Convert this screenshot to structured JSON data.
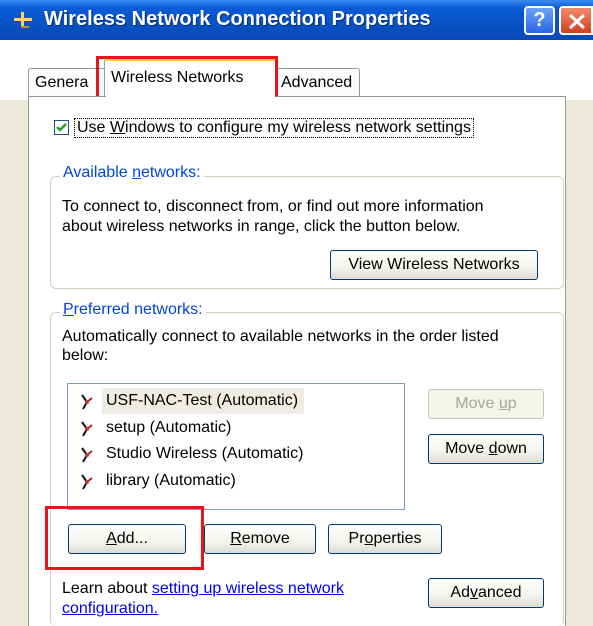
{
  "window": {
    "title": "Wireless Network Connection Properties",
    "help_label": "?"
  },
  "tabs": [
    {
      "label": "Genera"
    },
    {
      "label": "Wireless Networks"
    },
    {
      "label": "Advanced"
    }
  ],
  "settings": {
    "use_windows_label_pre": "Use ",
    "use_windows_label_accel": "W",
    "use_windows_label_post": "indows to configure my wireless network settings",
    "use_windows_checked": true
  },
  "available": {
    "legend_pre": "Available ",
    "legend_accel": "n",
    "legend_post": "etworks:",
    "desc_line1": "To connect to, disconnect from, or find out more information",
    "desc_line2": "about wireless networks in range, click the button below.",
    "view_button": "View Wireless Networks"
  },
  "preferred": {
    "legend_pre": "",
    "legend_accel": "P",
    "legend_post": "referred networks:",
    "desc_line1": "Automatically connect to available networks in the order listed",
    "desc_line2": "below:",
    "networks": [
      {
        "label": "USF-NAC-Test (Automatic)"
      },
      {
        "label": "setup (Automatic)"
      },
      {
        "label": "Studio Wireless (Automatic)"
      },
      {
        "label": "library (Automatic)"
      }
    ],
    "move_up_pre": "Move ",
    "move_up_accel": "u",
    "move_up_post": "p",
    "move_down_pre": "Move ",
    "move_down_accel": "d",
    "move_down_post": "own",
    "add_accel": "A",
    "add_post": "dd...",
    "remove_accel": "R",
    "remove_post": "emove",
    "properties_pre": "Pr",
    "properties_accel": "o",
    "properties_post": "perties"
  },
  "footer": {
    "learn_prefix": "Learn about ",
    "learn_link_line1": "setting up wireless network",
    "learn_link_line2": "configuration.",
    "advanced_pre": "Ad",
    "advanced_accel": "v",
    "advanced_post": "anced"
  },
  "colors": {
    "titlebar": "#0852c6",
    "highlight_box": "#e8141b",
    "legend_text": "#0046d5"
  }
}
